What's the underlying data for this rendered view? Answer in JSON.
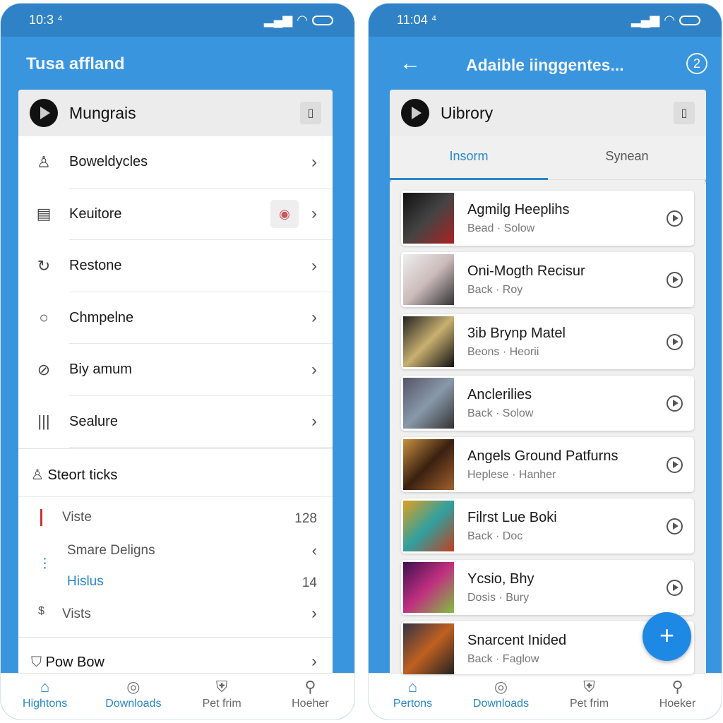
{
  "colors": {
    "primary": "#3a95df",
    "status_bar": "#2f82c6",
    "accent_text": "#2a86c9"
  },
  "left": {
    "status_time": "10:3 ⁴",
    "title": "Tusa affland",
    "card_title": "Mungrais",
    "rows": [
      {
        "icon": "person-icon",
        "label": "Boweldycles"
      },
      {
        "icon": "list-icon",
        "label": "Keuitore"
      },
      {
        "icon": "refresh-icon",
        "label": "Restone"
      },
      {
        "icon": "chat-icon",
        "label": "Chmpelne"
      },
      {
        "icon": "compass-icon",
        "label": "Biy amum"
      },
      {
        "icon": "bars-icon",
        "label": "Sealure"
      }
    ],
    "section_title": "Steort ticks",
    "sub": [
      {
        "label": "Viste",
        "value": "128"
      },
      {
        "label": "Smare Deligns"
      },
      {
        "label": "Hislus",
        "value": "14"
      },
      {
        "label": "Vists"
      }
    ],
    "last_row": "Pow Bow",
    "nav": [
      "Hightons",
      "Downloads",
      "Pet frim",
      "Hoeher"
    ]
  },
  "right": {
    "status_time": "11:04 ⁴",
    "title": "Adaible iinggentes...",
    "card_title": "Uibrory",
    "tabs": [
      "Insorm",
      "Synean"
    ],
    "items": [
      {
        "title": "Agmilg Heeplihs",
        "sub": "Bead · Solow"
      },
      {
        "title": "Oni-Mogth Recisur",
        "sub": "Back · Roy"
      },
      {
        "title": "3ib Brynp Matel",
        "sub": "Beons · Heorii"
      },
      {
        "title": "Anclerilies",
        "sub": "Back · Solow"
      },
      {
        "title": "Angels Ground Patfurns",
        "sub": "Heplese · Hanher"
      },
      {
        "title": "Filrst Lue Boki",
        "sub": "Back · Doc"
      },
      {
        "title": "Ycsio, Bhy",
        "sub": "Dosis · Bury"
      },
      {
        "title": "Snarcent Inided",
        "sub": "Back · Faglow"
      }
    ],
    "nav": [
      "Pertons",
      "Downloads",
      "Pet frim",
      "Hoeker"
    ]
  }
}
